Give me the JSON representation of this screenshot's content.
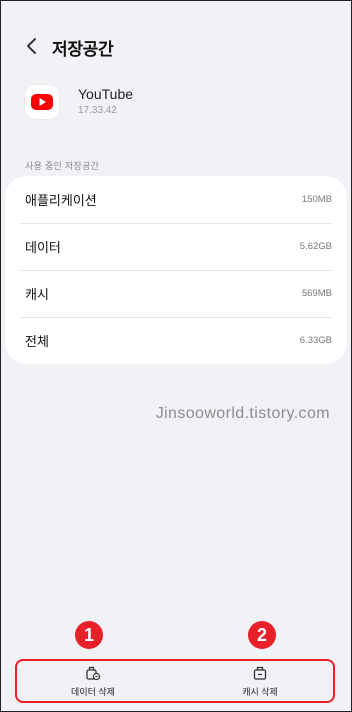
{
  "header": {
    "title": "저장공간"
  },
  "app": {
    "name": "YouTube",
    "version": "17.33.42"
  },
  "storage": {
    "section_label": "사용 중인 저장공간",
    "rows": [
      {
        "label": "애플리케이션",
        "value": "150MB"
      },
      {
        "label": "데이터",
        "value": "5.62GB"
      },
      {
        "label": "캐시",
        "value": "569MB"
      },
      {
        "label": "전체",
        "value": "6.33GB"
      }
    ]
  },
  "watermark": "Jinsooworld.tistory.com",
  "annotations": {
    "badge_1": "1",
    "badge_2": "2",
    "highlight_color": "#e8202a"
  },
  "bottom_actions": {
    "clear_data": {
      "label": "데이터 삭제",
      "icon": "clear-data-icon"
    },
    "clear_cache": {
      "label": "캐시 삭제",
      "icon": "clear-cache-icon"
    }
  },
  "colors": {
    "background": "#f0f2f5",
    "card": "#ffffff",
    "youtube_red": "#ff0000"
  }
}
